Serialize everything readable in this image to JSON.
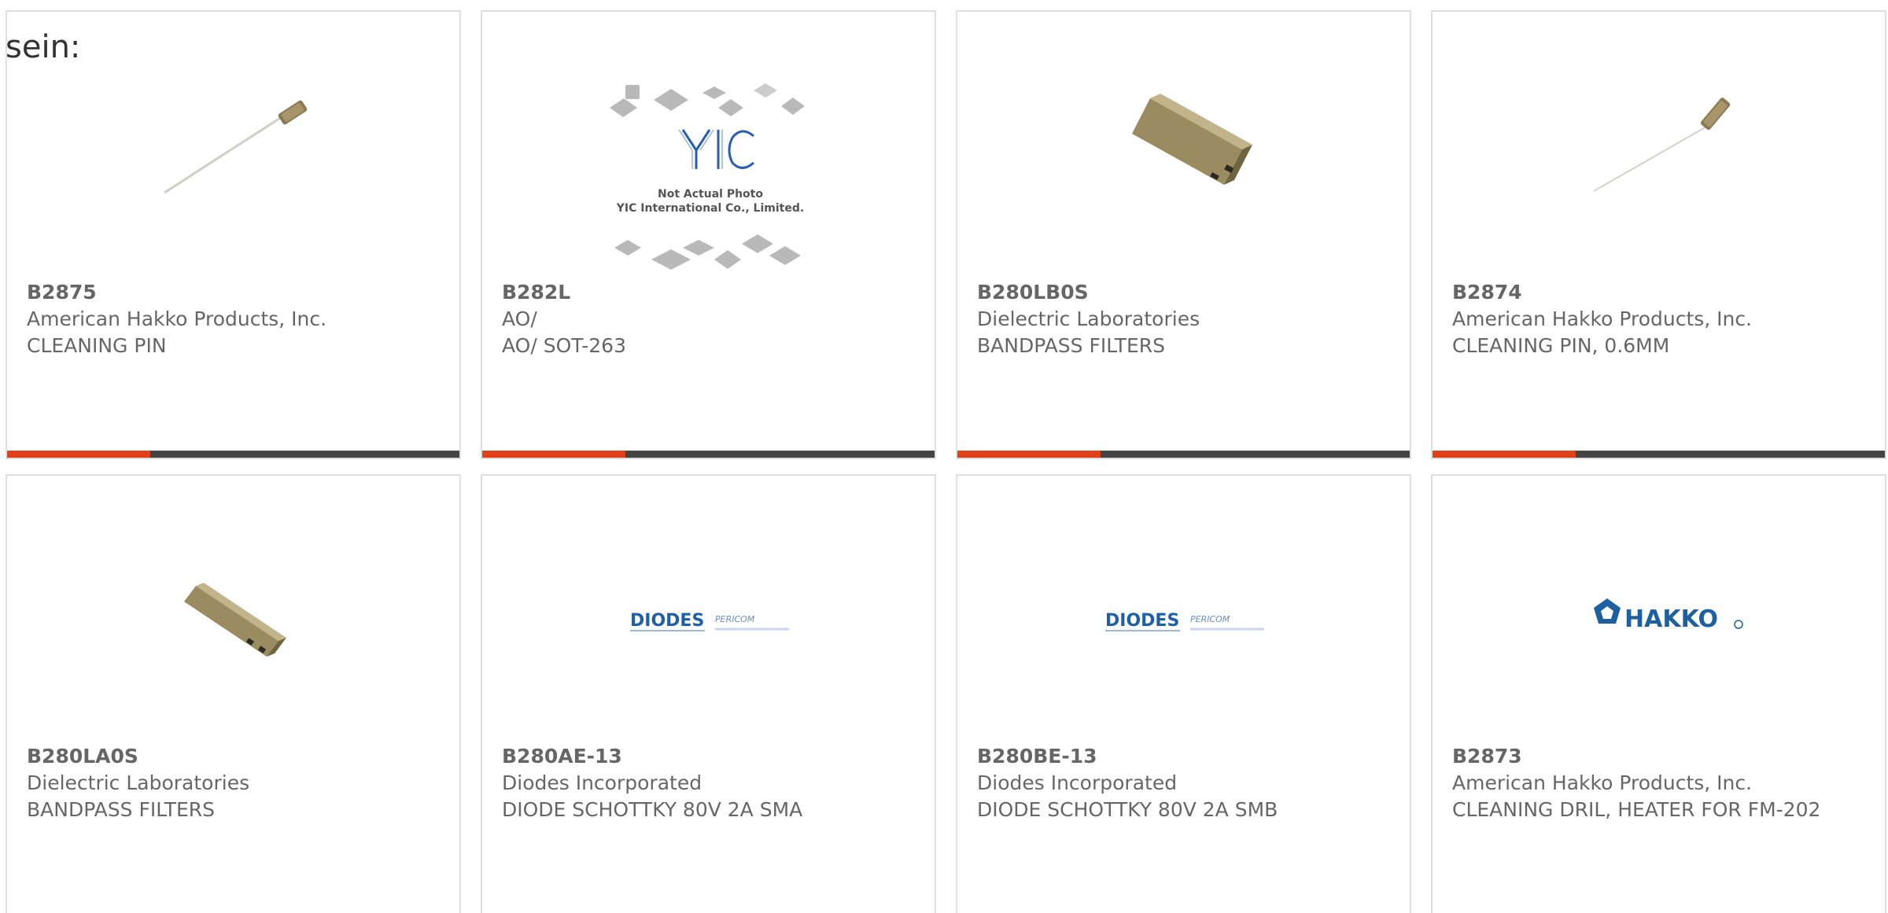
{
  "intro_text": "sein:",
  "colors": {
    "card_border": "#dedede",
    "text": "#666666",
    "bar_dark": "#444444",
    "bar_accent": "#e0401a",
    "diodes_blue": "#1f5fa8",
    "hakko_blue": "#1e5fa0"
  },
  "products": [
    {
      "part_number": "B2875",
      "manufacturer": "American Hakko Products, Inc.",
      "description": "CLEANING PIN",
      "image": "cleaning-pin-photo"
    },
    {
      "part_number": "B282L",
      "manufacturer": "AO/",
      "description": "AO/ SOT-263",
      "image": "not-actual-photo-placeholder",
      "image_caption_line1": "Not Actual Photo",
      "image_caption_line2": "YIC International Co., Limited.",
      "image_logo_text": "YIC"
    },
    {
      "part_number": "B280LB0S",
      "manufacturer": "Dielectric Laboratories",
      "description": "BANDPASS FILTERS",
      "image": "bandpass-filter-photo"
    },
    {
      "part_number": "B2874",
      "manufacturer": "American Hakko Products, Inc.",
      "description": "CLEANING PIN, 0.6MM",
      "image": "cleaning-pin-photo"
    },
    {
      "part_number": "B280LA0S",
      "manufacturer": "Dielectric Laboratories",
      "description": "BANDPASS FILTERS",
      "image": "bandpass-filter-photo"
    },
    {
      "part_number": "B280AE-13",
      "manufacturer": "Diodes Incorporated",
      "description": "DIODE SCHOTTKY 80V 2A SMA",
      "image": "diodes-pericom-logo",
      "logo_text": "DIODES",
      "logo_sub": "PERICOM"
    },
    {
      "part_number": "B280BE-13",
      "manufacturer": "Diodes Incorporated",
      "description": "DIODE SCHOTTKY 80V 2A SMB",
      "image": "diodes-pericom-logo",
      "logo_text": "DIODES",
      "logo_sub": "PERICOM"
    },
    {
      "part_number": "B2873",
      "manufacturer": "American Hakko Products, Inc.",
      "description": "CLEANING DRIL, HEATER FOR FM-202",
      "image": "hakko-logo",
      "logo_text": "HAKKO"
    }
  ]
}
